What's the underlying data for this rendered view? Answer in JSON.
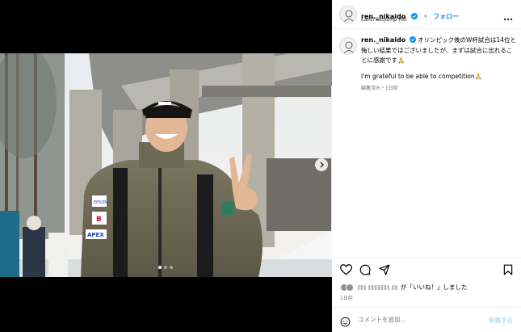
{
  "post": {
    "username": "ren._nikaido",
    "verified_icon": "verified-badge-icon",
    "separator": "•",
    "follow_label": "フォロー",
    "location": "Lahti Skijump Hill",
    "caption_username": "ren._nikaido",
    "caption_jp": "オリンピック後のW杯試合は14位と悔しい結果ではございましたが、まずは試合に出れることに感謝です🙏",
    "caption_en": "I'm grateful to be able to competition🙏",
    "caption_meta": "編集済み・1日前",
    "likes_text": "が「いいね！」しました",
    "time": "1日前",
    "comment_placeholder": "コメントを追加...",
    "post_label": "投稿する"
  },
  "media": {
    "photo_alt": "Ski jumper in front of Lahti ski jump towers",
    "slide_count": 3,
    "current_slide": 1,
    "sponsor_1": "EPSON",
    "sponsor_2": "B",
    "sponsor_3": "APEX"
  },
  "colors": {
    "accent": "#0095f6",
    "post_disabled": "#b2dffc",
    "muted": "#737373"
  }
}
